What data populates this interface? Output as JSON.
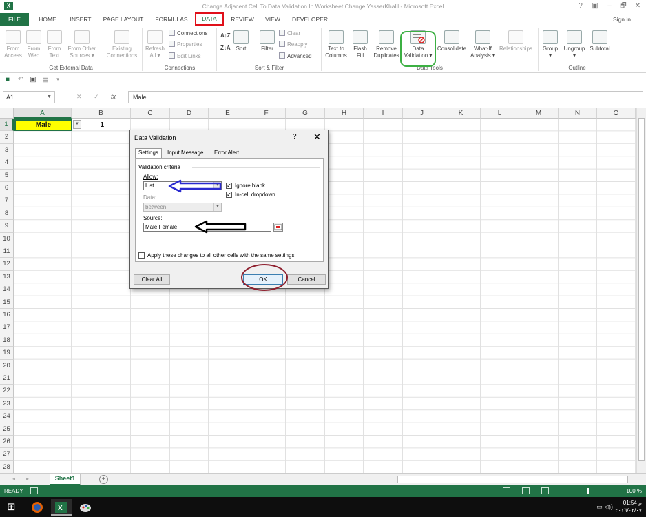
{
  "window": {
    "title": "Change Adjacent Cell To Data Validation In Worksheet Change YasserKhalil - Microsoft Excel",
    "logo": "X",
    "controls": [
      "?",
      "▣",
      "–",
      "🗗",
      "✕"
    ]
  },
  "tabs": {
    "file": "FILE",
    "home": "HOME",
    "insert": "INSERT",
    "page_layout": "PAGE LAYOUT",
    "formulas": "FORMULAS",
    "data": "DATA",
    "review": "REVIEW",
    "view": "VIEW",
    "developer": "DEVELOPER",
    "sign_in": "Sign in"
  },
  "ribbon": {
    "get_external": {
      "label": "Get External Data",
      "from_access": [
        "From",
        "Access"
      ],
      "from_web": [
        "From",
        "Web"
      ],
      "from_text": [
        "From",
        "Text"
      ],
      "from_other": [
        "From Other",
        "Sources ▾"
      ],
      "existing": [
        "Existing",
        "Connections"
      ]
    },
    "connections": {
      "label": "Connections",
      "refresh": [
        "Refresh",
        "All ▾"
      ],
      "connections": "Connections",
      "properties": "Properties",
      "edit_links": "Edit Links"
    },
    "sort_filter": {
      "label": "Sort & Filter",
      "az": "A↓Z",
      "za": "Z↓A",
      "sort": "Sort",
      "filter": "Filter",
      "clear": "Clear",
      "reapply": "Reapply",
      "advanced": "Advanced"
    },
    "data_tools": {
      "label": "Data Tools",
      "text_to_columns": [
        "Text to",
        "Columns"
      ],
      "flash_fill": [
        "Flash",
        "Fill"
      ],
      "remove_duplicates": [
        "Remove",
        "Duplicates"
      ],
      "data_validation": [
        "Data",
        "Validation ▾"
      ],
      "consolidate": [
        "Consolidate",
        ""
      ],
      "what_if": [
        "What-If",
        "Analysis ▾"
      ],
      "relationships": [
        "Relationships",
        ""
      ]
    },
    "outline": {
      "label": "Outline",
      "group": [
        "Group",
        "▾"
      ],
      "ungroup": [
        "Ungroup",
        "▾"
      ],
      "subtotal": [
        "Subtotal",
        ""
      ]
    }
  },
  "formula_bar": {
    "name_box": "A1",
    "fx": "fx",
    "value": "Male"
  },
  "sheet": {
    "columns": [
      "A",
      "B",
      "C",
      "D",
      "E",
      "F",
      "G",
      "H",
      "I",
      "J",
      "K",
      "L",
      "M",
      "N",
      "O"
    ],
    "rows": [
      "1",
      "2",
      "3",
      "4",
      "5",
      "6",
      "7",
      "8",
      "9",
      "10",
      "11",
      "12",
      "13",
      "14",
      "15",
      "16",
      "17",
      "18",
      "19",
      "20",
      "21",
      "22",
      "23",
      "24",
      "25",
      "26",
      "27",
      "28"
    ],
    "a1": "Male",
    "b1": "1",
    "tab": "Sheet1",
    "add_sheet": "+"
  },
  "status": {
    "ready": "READY",
    "zoom": "100 %"
  },
  "dialog": {
    "title": "Data Validation",
    "help": "?",
    "close": "✕",
    "tabs": [
      "Settings",
      "Input Message",
      "Error Alert"
    ],
    "criteria": "Validation criteria",
    "allow_label": "Allow:",
    "allow_value": "List",
    "ignore_blank": "Ignore blank",
    "in_cell_dropdown": "In-cell dropdown",
    "data_label": "Data:",
    "data_value": "between",
    "source_label": "Source:",
    "source_value": "Male,Female",
    "apply_all": "Apply these changes to all other cells with the same settings",
    "clear_all": "Clear All",
    "ok": "OK",
    "cancel": "Cancel"
  },
  "taskbar": {
    "start": "⊞",
    "time": "01:54 م",
    "date": "٢٠١٦/٠٣/٠٧"
  },
  "colors": {
    "excel_green": "#217346",
    "data_tab_outline": "#e0101a",
    "validation_highlight": "#3cb043",
    "ok_circle": "#8e1f2e",
    "allow_arrow": "#2a2acf",
    "source_arrow": "#000000",
    "a1_fill": "#ffff00"
  }
}
